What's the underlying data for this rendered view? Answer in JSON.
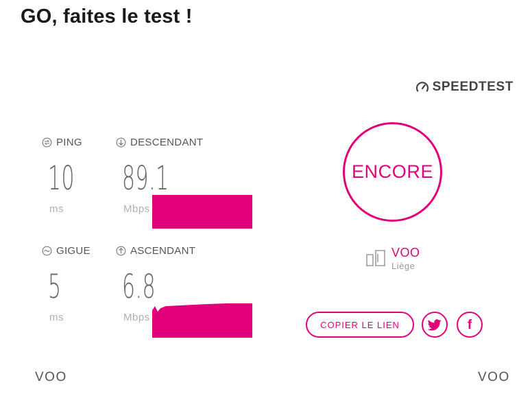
{
  "page": {
    "title": "GO, faites le test !"
  },
  "brand": {
    "label": "SPEEDTEST",
    "icon": "speedometer-icon"
  },
  "metrics": {
    "ping": {
      "label": "PING",
      "value": "10",
      "unit": "ms",
      "icon": "ping-icon"
    },
    "download": {
      "label": "DESCENDANT",
      "value": "89.1",
      "unit": "Mbps",
      "icon": "download-arrow-icon"
    },
    "jitter": {
      "label": "GIGUE",
      "value": "5",
      "unit": "ms",
      "icon": "jitter-icon"
    },
    "upload": {
      "label": "ASCENDANT",
      "value": "6.8",
      "unit": "Mbps",
      "icon": "upload-arrow-icon"
    }
  },
  "actions": {
    "retry_label": "ENCORE",
    "copy_link_label": "COPIER LE LIEN",
    "twitter_icon": "twitter-icon",
    "facebook_icon": "facebook-icon",
    "facebook_glyph": "f"
  },
  "server": {
    "provider": "VOO",
    "location": "Liège",
    "icon": "server-icon"
  },
  "footer": {
    "left": "VOO",
    "right": "VOO"
  },
  "colors": {
    "accent": "#e2007a",
    "text_dark": "#1a1a1a",
    "text_muted": "#9a9a9a"
  }
}
